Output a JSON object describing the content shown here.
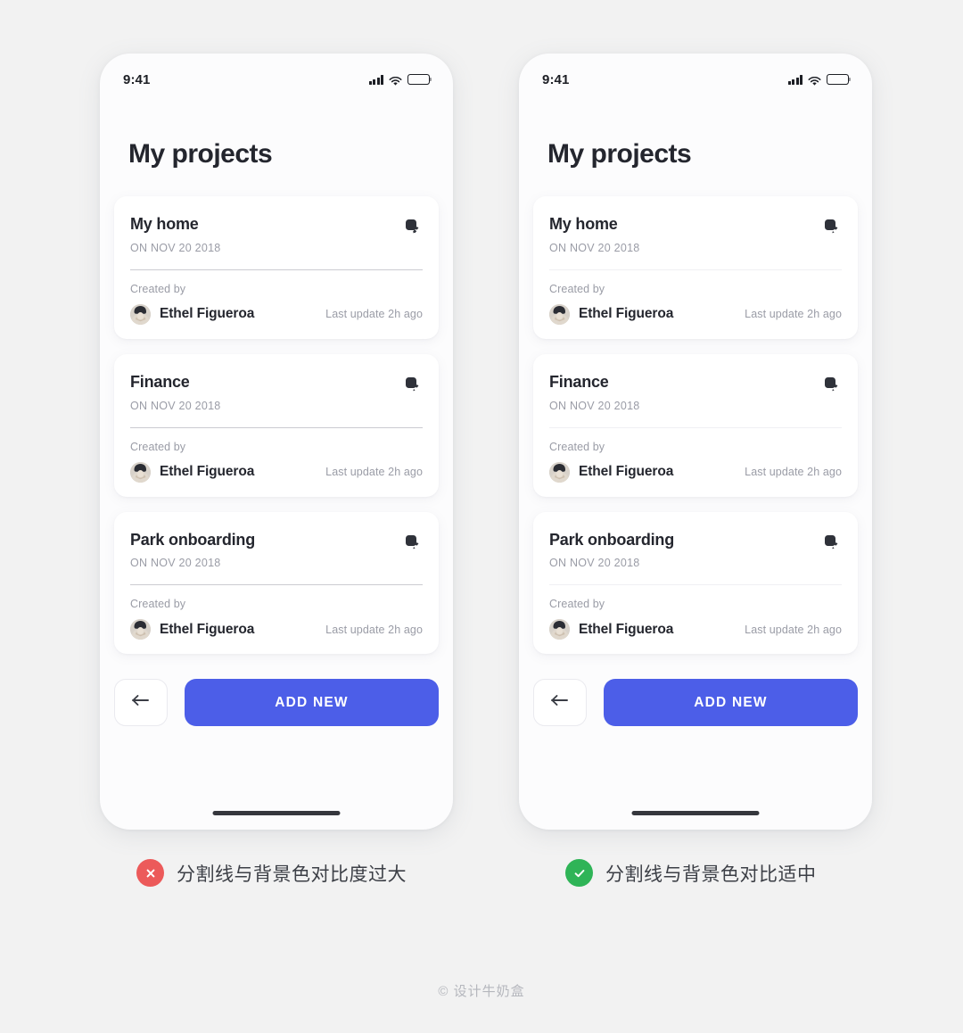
{
  "page": {
    "background_color": "#f2f2f2",
    "watermark": "© 设计牛奶盒"
  },
  "status_bar": {
    "time": "9:41",
    "icons": [
      "signal-icon",
      "wifi-icon",
      "battery-icon"
    ]
  },
  "screen": {
    "title": "My projects",
    "cards": [
      {
        "title": "My home",
        "date": "ON NOV 20 2018",
        "created_by_label": "Created by",
        "author": "Ethel Figueroa",
        "last_update": "Last update 2h ago",
        "edit_icon": "edit-icon"
      },
      {
        "title": "Finance",
        "date": "ON NOV 20 2018",
        "created_by_label": "Created by",
        "author": "Ethel Figueroa",
        "last_update": "Last update 2h ago",
        "edit_icon": "edit-icon"
      },
      {
        "title": "Park onboarding",
        "date": "ON NOV 20 2018",
        "created_by_label": "Created by",
        "author": "Ethel Figueroa",
        "last_update": "Last update 2h ago",
        "edit_icon": "edit-icon"
      }
    ],
    "actions": {
      "back_icon": "arrow-left-icon",
      "add_label": "ADD NEW",
      "add_color": "#4c5ee8"
    }
  },
  "variants": {
    "left": {
      "divider_color": "#cbcbd1",
      "badge": "cross-icon",
      "badge_color": "#ec5a5a",
      "caption": "分割线与背景色对比度过大"
    },
    "right": {
      "divider_color": "#f0f0f3",
      "badge": "check-icon",
      "badge_color": "#2fb457",
      "caption": "分割线与背景色对比适中"
    }
  }
}
